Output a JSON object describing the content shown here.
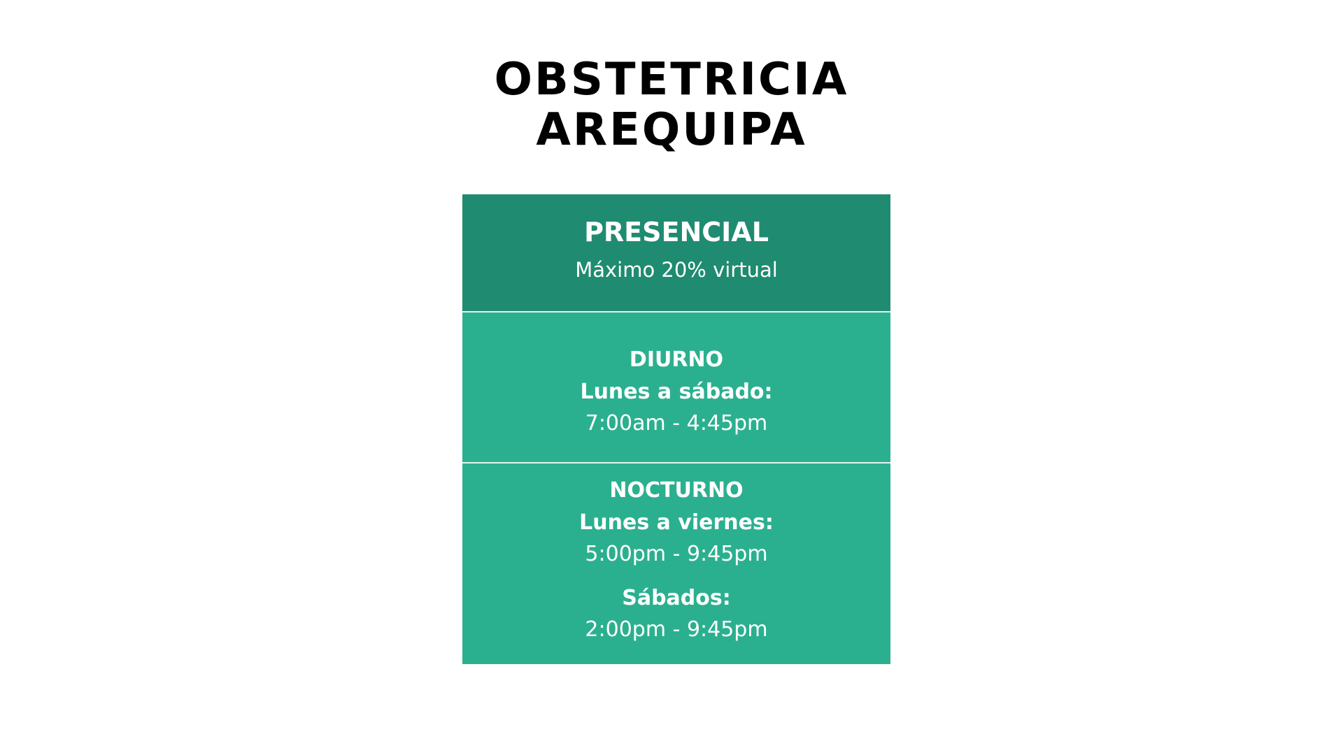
{
  "title": {
    "line1": "OBSTETRICIA",
    "line2": "AREQUIPA"
  },
  "modality": {
    "label": "PRESENCIAL",
    "note": "Máximo 20% virtual"
  },
  "diurno": {
    "label": "DIURNO",
    "days": "Lunes a sábado:",
    "hours": "7:00am - 4:45pm"
  },
  "nocturno": {
    "label": "NOCTURNO",
    "weekdays": "Lunes a viernes:",
    "weekday_hours": "5:00pm - 9:45pm",
    "saturday": "Sábados:",
    "saturday_hours": "2:00pm - 9:45pm"
  },
  "colors": {
    "header_bg": "#1f8b70",
    "block_bg": "#2bb08f",
    "text_on_green": "#ffffff",
    "title_text": "#000000"
  }
}
